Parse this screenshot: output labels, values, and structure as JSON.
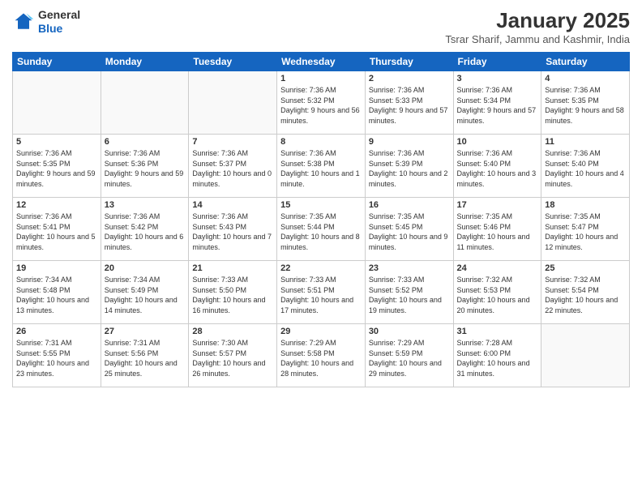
{
  "header": {
    "logo_line1": "General",
    "logo_line2": "Blue",
    "month_title": "January 2025",
    "location": "Tsrar Sharif, Jammu and Kashmir, India"
  },
  "weekdays": [
    "Sunday",
    "Monday",
    "Tuesday",
    "Wednesday",
    "Thursday",
    "Friday",
    "Saturday"
  ],
  "weeks": [
    [
      {
        "day": "",
        "empty": true
      },
      {
        "day": "",
        "empty": true
      },
      {
        "day": "",
        "empty": true
      },
      {
        "day": "1",
        "sunrise": "7:36 AM",
        "sunset": "5:32 PM",
        "daylight": "9 hours and 56 minutes."
      },
      {
        "day": "2",
        "sunrise": "7:36 AM",
        "sunset": "5:33 PM",
        "daylight": "9 hours and 57 minutes."
      },
      {
        "day": "3",
        "sunrise": "7:36 AM",
        "sunset": "5:34 PM",
        "daylight": "9 hours and 57 minutes."
      },
      {
        "day": "4",
        "sunrise": "7:36 AM",
        "sunset": "5:35 PM",
        "daylight": "9 hours and 58 minutes."
      }
    ],
    [
      {
        "day": "5",
        "sunrise": "7:36 AM",
        "sunset": "5:35 PM",
        "daylight": "9 hours and 59 minutes."
      },
      {
        "day": "6",
        "sunrise": "7:36 AM",
        "sunset": "5:36 PM",
        "daylight": "9 hours and 59 minutes."
      },
      {
        "day": "7",
        "sunrise": "7:36 AM",
        "sunset": "5:37 PM",
        "daylight": "10 hours and 0 minutes."
      },
      {
        "day": "8",
        "sunrise": "7:36 AM",
        "sunset": "5:38 PM",
        "daylight": "10 hours and 1 minute."
      },
      {
        "day": "9",
        "sunrise": "7:36 AM",
        "sunset": "5:39 PM",
        "daylight": "10 hours and 2 minutes."
      },
      {
        "day": "10",
        "sunrise": "7:36 AM",
        "sunset": "5:40 PM",
        "daylight": "10 hours and 3 minutes."
      },
      {
        "day": "11",
        "sunrise": "7:36 AM",
        "sunset": "5:40 PM",
        "daylight": "10 hours and 4 minutes."
      }
    ],
    [
      {
        "day": "12",
        "sunrise": "7:36 AM",
        "sunset": "5:41 PM",
        "daylight": "10 hours and 5 minutes."
      },
      {
        "day": "13",
        "sunrise": "7:36 AM",
        "sunset": "5:42 PM",
        "daylight": "10 hours and 6 minutes."
      },
      {
        "day": "14",
        "sunrise": "7:36 AM",
        "sunset": "5:43 PM",
        "daylight": "10 hours and 7 minutes."
      },
      {
        "day": "15",
        "sunrise": "7:35 AM",
        "sunset": "5:44 PM",
        "daylight": "10 hours and 8 minutes."
      },
      {
        "day": "16",
        "sunrise": "7:35 AM",
        "sunset": "5:45 PM",
        "daylight": "10 hours and 9 minutes."
      },
      {
        "day": "17",
        "sunrise": "7:35 AM",
        "sunset": "5:46 PM",
        "daylight": "10 hours and 11 minutes."
      },
      {
        "day": "18",
        "sunrise": "7:35 AM",
        "sunset": "5:47 PM",
        "daylight": "10 hours and 12 minutes."
      }
    ],
    [
      {
        "day": "19",
        "sunrise": "7:34 AM",
        "sunset": "5:48 PM",
        "daylight": "10 hours and 13 minutes."
      },
      {
        "day": "20",
        "sunrise": "7:34 AM",
        "sunset": "5:49 PM",
        "daylight": "10 hours and 14 minutes."
      },
      {
        "day": "21",
        "sunrise": "7:33 AM",
        "sunset": "5:50 PM",
        "daylight": "10 hours and 16 minutes."
      },
      {
        "day": "22",
        "sunrise": "7:33 AM",
        "sunset": "5:51 PM",
        "daylight": "10 hours and 17 minutes."
      },
      {
        "day": "23",
        "sunrise": "7:33 AM",
        "sunset": "5:52 PM",
        "daylight": "10 hours and 19 minutes."
      },
      {
        "day": "24",
        "sunrise": "7:32 AM",
        "sunset": "5:53 PM",
        "daylight": "10 hours and 20 minutes."
      },
      {
        "day": "25",
        "sunrise": "7:32 AM",
        "sunset": "5:54 PM",
        "daylight": "10 hours and 22 minutes."
      }
    ],
    [
      {
        "day": "26",
        "sunrise": "7:31 AM",
        "sunset": "5:55 PM",
        "daylight": "10 hours and 23 minutes."
      },
      {
        "day": "27",
        "sunrise": "7:31 AM",
        "sunset": "5:56 PM",
        "daylight": "10 hours and 25 minutes."
      },
      {
        "day": "28",
        "sunrise": "7:30 AM",
        "sunset": "5:57 PM",
        "daylight": "10 hours and 26 minutes."
      },
      {
        "day": "29",
        "sunrise": "7:29 AM",
        "sunset": "5:58 PM",
        "daylight": "10 hours and 28 minutes."
      },
      {
        "day": "30",
        "sunrise": "7:29 AM",
        "sunset": "5:59 PM",
        "daylight": "10 hours and 29 minutes."
      },
      {
        "day": "31",
        "sunrise": "7:28 AM",
        "sunset": "6:00 PM",
        "daylight": "10 hours and 31 minutes."
      },
      {
        "day": "",
        "empty": true
      }
    ]
  ]
}
